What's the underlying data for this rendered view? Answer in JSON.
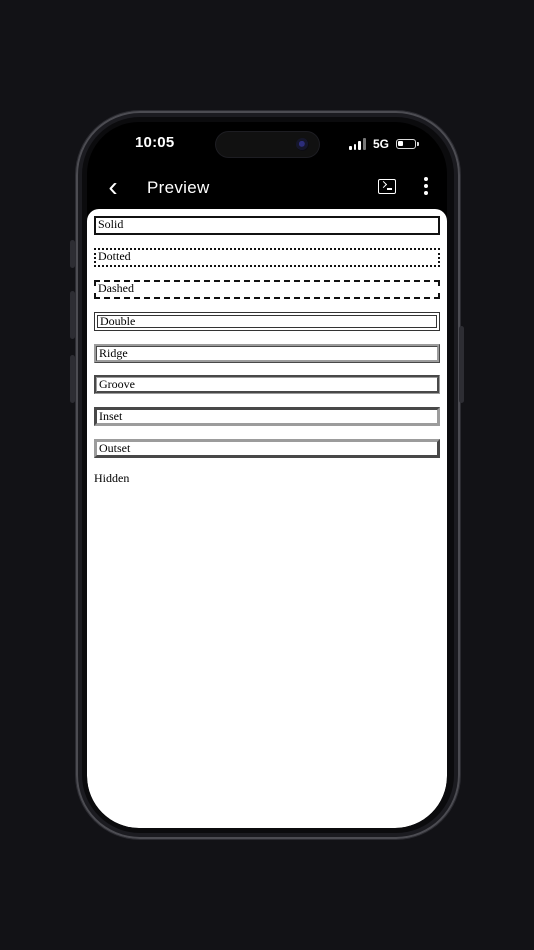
{
  "status_bar": {
    "time": "10:05",
    "network": "5G"
  },
  "toolbar": {
    "back_icon": "chevron-left-icon",
    "title": "Preview",
    "terminal_icon": "terminal-icon",
    "more_icon": "more-vertical-icon"
  },
  "preview": {
    "items": [
      {
        "label": "Solid"
      },
      {
        "label": "Dotted"
      },
      {
        "label": "Dashed"
      },
      {
        "label": "Double"
      },
      {
        "label": "Ridge"
      },
      {
        "label": "Groove"
      },
      {
        "label": "Inset"
      },
      {
        "label": "Outset"
      },
      {
        "label": "Hidden"
      }
    ]
  },
  "colors": {
    "background": "#121216",
    "toolbar": "#000000",
    "preview_background": "#ffffff",
    "text": "#000000"
  }
}
